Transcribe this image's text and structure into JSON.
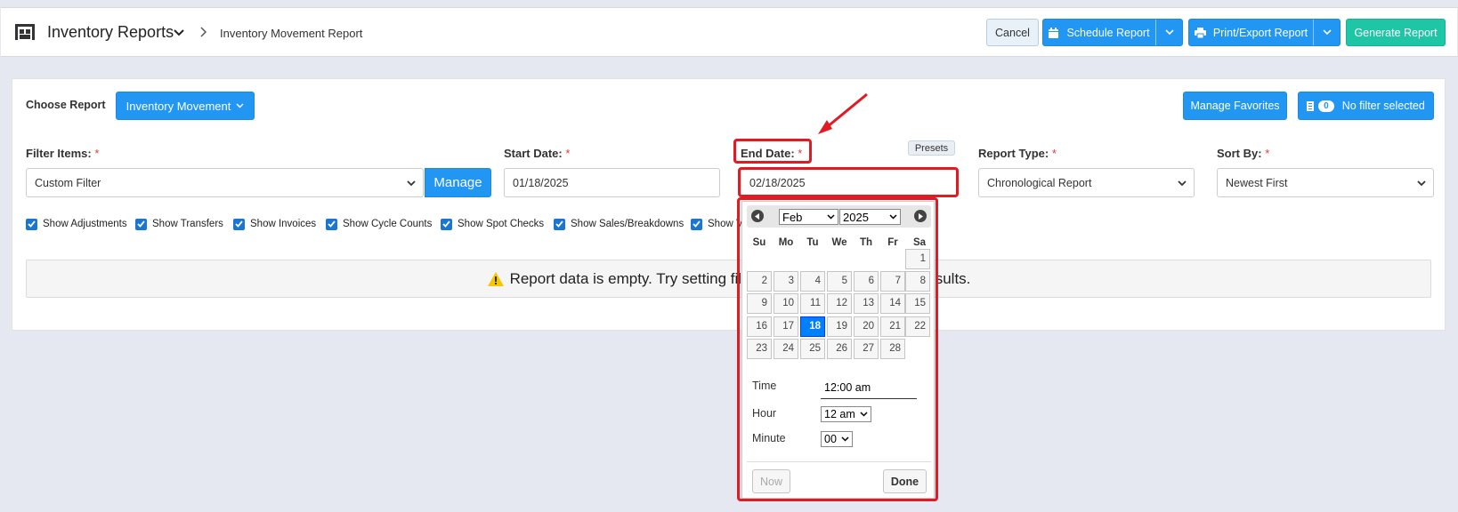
{
  "header": {
    "app_title": "Inventory Reports",
    "breadcrumb": "Inventory Movement Report",
    "cancel_label": "Cancel",
    "schedule_label": "Schedule Report",
    "print_label": "Print/Export Report",
    "generate_label": "Generate Report"
  },
  "report": {
    "choose_label": "Choose Report",
    "selected_report": "Inventory Movement",
    "manage_favorites_label": "Manage Favorites",
    "filter_count": "0",
    "filter_status": "No filter selected"
  },
  "filters": {
    "filter_items_label": "Filter Items:",
    "filter_items_value": "Custom Filter",
    "manage_label": "Manage",
    "start_date_label": "Start Date:",
    "start_date_value": "01/18/2025",
    "end_date_label": "End Date:",
    "end_date_value": "02/18/2025",
    "presets_label": "Presets",
    "report_type_label": "Report Type:",
    "report_type_value": "Chronological Report",
    "sort_by_label": "Sort By:",
    "sort_by_value": "Newest First",
    "required_mark": "*"
  },
  "checkboxes": [
    {
      "label": "Show Adjustments",
      "checked": true
    },
    {
      "label": "Show Transfers",
      "checked": true
    },
    {
      "label": "Show Invoices",
      "checked": true
    },
    {
      "label": "Show Cycle Counts",
      "checked": true
    },
    {
      "label": "Show Spot Checks",
      "checked": true
    },
    {
      "label": "Show Sales/Breakdowns",
      "checked": true
    },
    {
      "label": "Show V",
      "checked": true
    }
  ],
  "empty_message": {
    "part1": "Report data is empty. Try setting filte",
    "part2": "r results."
  },
  "datepicker": {
    "month": "Feb",
    "year": "2025",
    "weekdays": [
      "Su",
      "Mo",
      "Tu",
      "We",
      "Th",
      "Fr",
      "Sa"
    ],
    "days": [
      "1",
      "2",
      "3",
      "4",
      "5",
      "6",
      "7",
      "8",
      "9",
      "10",
      "11",
      "12",
      "13",
      "14",
      "15",
      "16",
      "17",
      "18",
      "19",
      "20",
      "21",
      "22",
      "23",
      "24",
      "25",
      "26",
      "27",
      "28"
    ],
    "selected_day": "18",
    "time_label": "Time",
    "time_value": "12:00 am",
    "hour_label": "Hour",
    "hour_value": "12 am",
    "minute_label": "Minute",
    "minute_value": "00",
    "now_label": "Now",
    "done_label": "Done"
  },
  "colors": {
    "primary": "#2196f3",
    "success": "#1ec6a6",
    "highlight": "#e01b24",
    "selected_day": "#007fff"
  }
}
